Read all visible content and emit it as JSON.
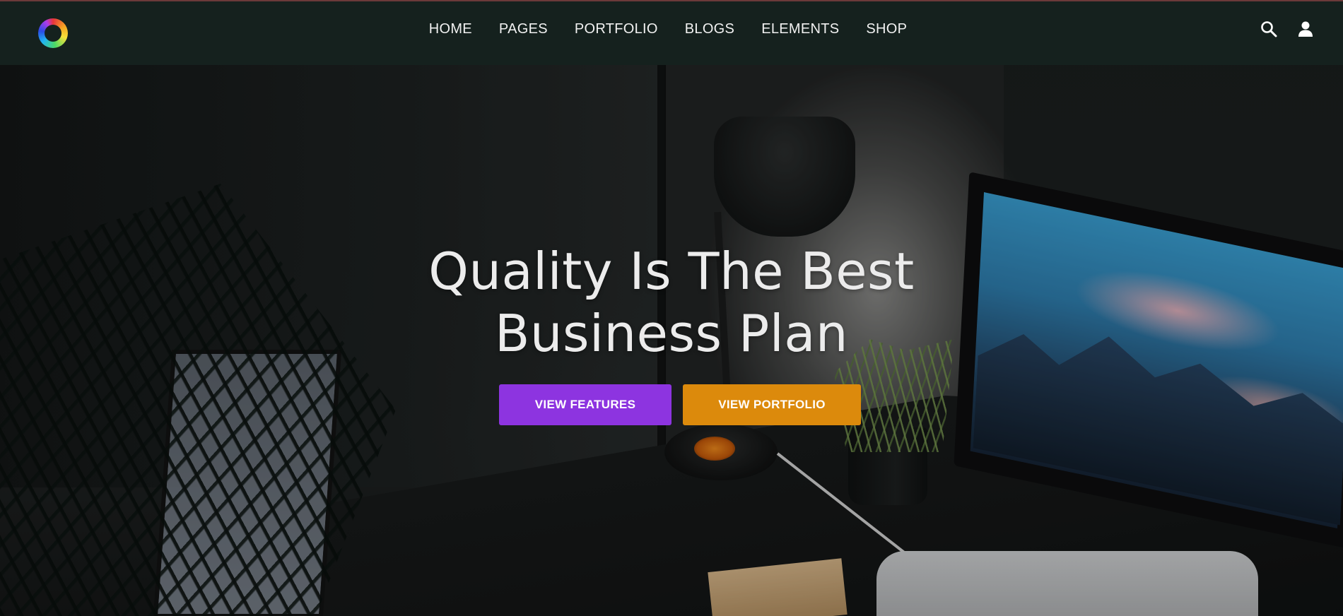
{
  "nav": {
    "logo": "color-ring-logo",
    "items": [
      {
        "label": "HOME"
      },
      {
        "label": "PAGES"
      },
      {
        "label": "PORTFOLIO"
      },
      {
        "label": "BLOGS"
      },
      {
        "label": "ELEMENTS"
      },
      {
        "label": "SHOP"
      }
    ],
    "icons": [
      "search-icon",
      "user-icon"
    ]
  },
  "hero": {
    "title_line1": "Quality Is The Best",
    "title_line2": "Business Plan",
    "buttons": {
      "features": "VIEW FEATURES",
      "portfolio": "VIEW PORTFOLIO"
    }
  },
  "colors": {
    "nav_bg": "#15211e",
    "features_button": "#8d34e0",
    "portfolio_button": "#dc8a0c",
    "title": "#ececec"
  }
}
